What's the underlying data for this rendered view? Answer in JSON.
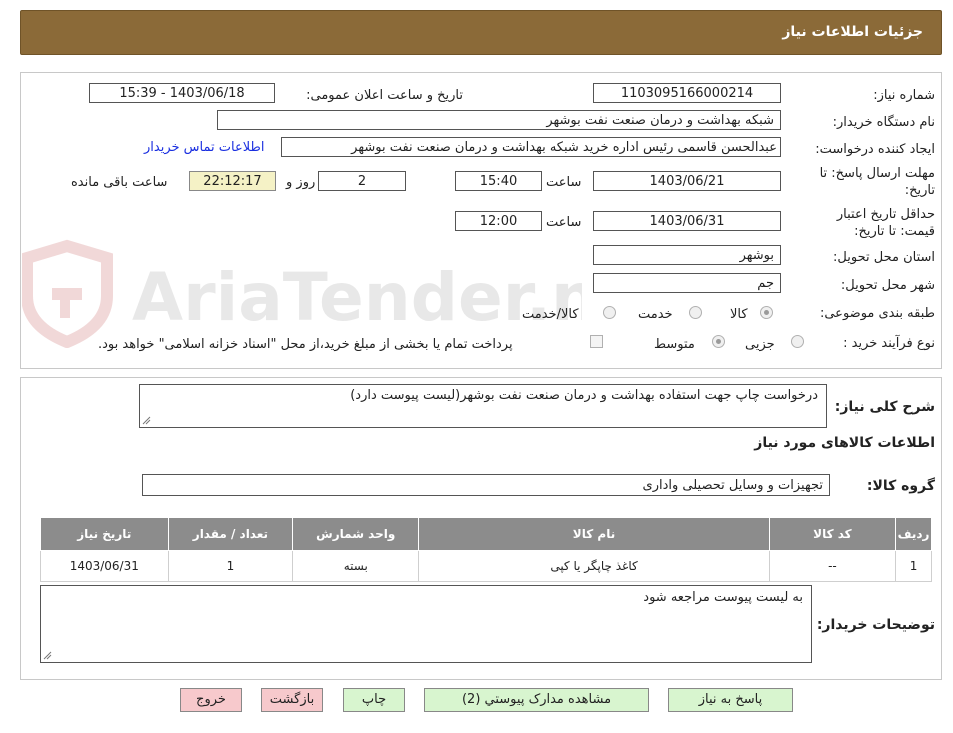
{
  "header": {
    "title": "جزئیات اطلاعات نیاز"
  },
  "watermark": {
    "text": "AriaTender.neT"
  },
  "form": {
    "need_number_label": "شماره نیاز:",
    "need_number": "1103095166000214",
    "announce_label": "تاریخ و ساعت اعلان عمومی:",
    "announce_value": "1403/06/18 - 15:39",
    "buyer_org_label": "نام دستگاه خریدار:",
    "buyer_org": "شبکه بهداشت و درمان صنعت نفت بوشهر",
    "creator_label": "ایجاد کننده درخواست:",
    "creator": "عبدالحسن قاسمی رئیس اداره خرید  شبکه بهداشت و درمان صنعت نفت بوشهر",
    "contact_link": "اطلاعات تماس خریدار",
    "deadline_label_1": "مهلت ارسال پاسخ: تا",
    "deadline_label_2": "تاریخ:",
    "deadline_date": "1403/06/21",
    "time_label": "ساعت",
    "deadline_time": "15:40",
    "days_value": "2",
    "days_label": "روز و",
    "remaining_time": "22:12:17",
    "remaining_label": "ساعت باقی مانده",
    "validity_label_1": "حداقل تاریخ اعتبار",
    "validity_label_2": "قیمت: تا تاریخ:",
    "validity_date": "1403/06/31",
    "validity_time": "12:00",
    "province_label": "استان محل تحویل:",
    "province": "بوشهر",
    "city_label": "شهر محل تحویل:",
    "city": "جم",
    "category_label": "طبقه بندی موضوعی:",
    "category_options": [
      "کالا",
      "خدمت",
      "کالا/خدمت"
    ],
    "category_selected": "کالا",
    "process_label": "نوع فرآیند خرید :",
    "process_options": [
      "جزیی",
      "متوسط"
    ],
    "process_selected": "متوسط",
    "payment_note": "پرداخت تمام یا بخشی از مبلغ خرید،از محل \"اسناد خزانه اسلامی\" خواهد بود."
  },
  "details": {
    "summary_label": "شرح کلی نیاز:",
    "summary": "درخواست چاپ جهت استفاده بهداشت و درمان صنعت نفت بوشهر(لیست پیوست دارد)",
    "goods_info_title": "اطلاعات کالاهای مورد نیاز",
    "goods_group_label": "گروه کالا:",
    "goods_group": "تجهیزات و وسایل تحصیلی واداری",
    "table": {
      "headers": [
        "ردیف",
        "کد کالا",
        "نام کالا",
        "واحد شمارش",
        "تعداد / مقدار",
        "تاریخ نیاز"
      ],
      "rows": [
        [
          "1",
          "--",
          "کاغذ چاپگر یا کپی",
          "بسته",
          "1",
          "1403/06/31"
        ]
      ]
    },
    "buyer_notes_label": "توضیحات خریدار:",
    "buyer_notes": "به لیست پیوست مراجعه شود"
  },
  "buttons": {
    "reply": "پاسخ به نیاز",
    "attachments": "مشاهده مدارک پیوستي (2)",
    "print": "چاپ",
    "back": "بازگشت",
    "exit": "خروج"
  }
}
